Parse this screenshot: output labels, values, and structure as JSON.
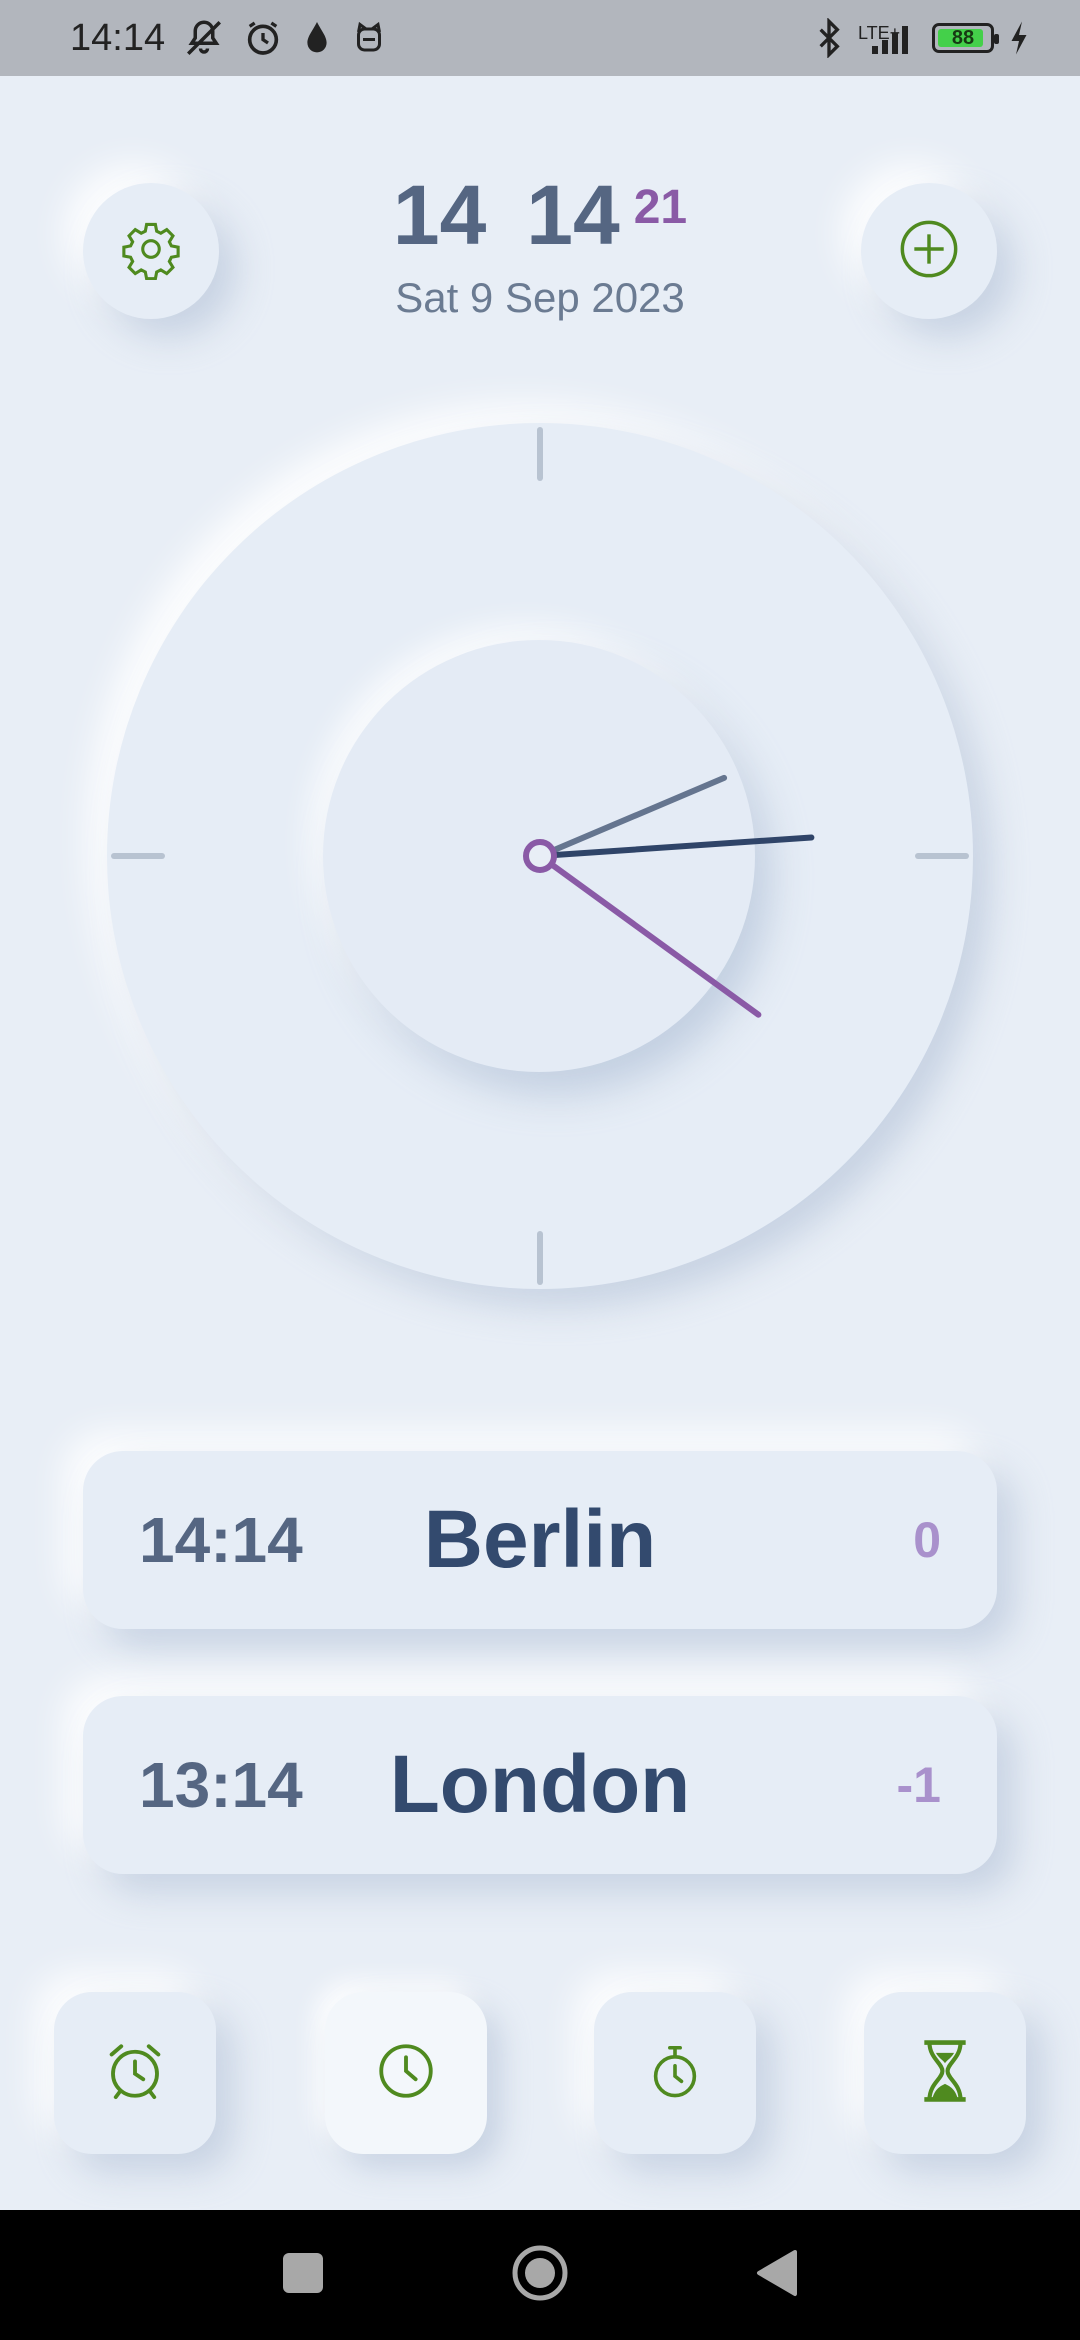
{
  "status_bar": {
    "time": "14:14",
    "network": "LTE+",
    "battery": "88",
    "battery_level": 0.88,
    "icons": [
      "mute-icon",
      "alarm-icon",
      "drop-icon",
      "cat-icon",
      "bluetooth-icon",
      "signal-icon",
      "charging-icon"
    ]
  },
  "header": {
    "hours": "14",
    "minutes": "14",
    "seconds": "21",
    "date": "Sat 9 Sep 2023"
  },
  "clock": {
    "hour": 14,
    "minute": 14,
    "second": 21
  },
  "cities": [
    {
      "time": "14:14",
      "name": "Berlin",
      "offset": "0"
    },
    {
      "time": "13:14",
      "name": "London",
      "offset": "-1"
    }
  ],
  "nav": [
    "alarm",
    "clock",
    "stopwatch",
    "timer"
  ],
  "colors": {
    "accent_green": "#4f8a1f",
    "seconds_purple": "#8a5aa6",
    "hour_hand": "#65758f",
    "minute_hand": "#2f4468",
    "background": "#e8eef6"
  }
}
